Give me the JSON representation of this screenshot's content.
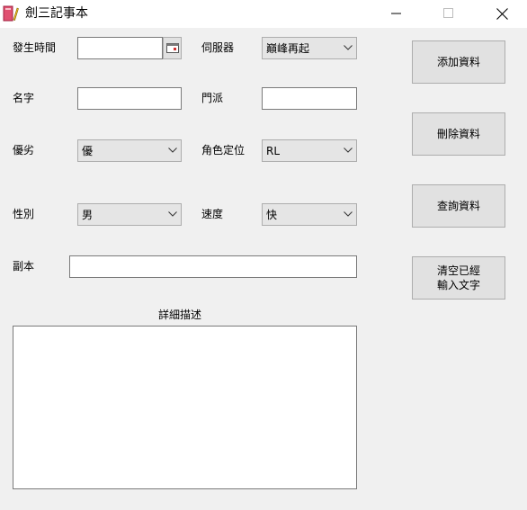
{
  "window": {
    "title": "劍三記事本"
  },
  "form": {
    "time_label": "發生時間",
    "time_value": "",
    "server_label": "伺服器",
    "server_value": "巔峰再起",
    "name_label": "名字",
    "name_value": "",
    "faction_label": "門派",
    "faction_value": "",
    "rating_label": "優劣",
    "rating_value": "優",
    "role_label": "角色定位",
    "role_value": "RL",
    "gender_label": "性別",
    "gender_value": "男",
    "speed_label": "速度",
    "speed_value": "快",
    "dungeon_label": "副本",
    "dungeon_value": "",
    "desc_label": "詳細描述",
    "desc_value": ""
  },
  "buttons": {
    "add": "添加資料",
    "delete": "刪除資料",
    "query": "查詢資料",
    "clear_line1": "清空已經",
    "clear_line2": "輸入文字"
  },
  "icons": {
    "app": "notebook-pencil-icon",
    "picker": "calendar-icon",
    "dropdown": "chevron-down-icon"
  }
}
